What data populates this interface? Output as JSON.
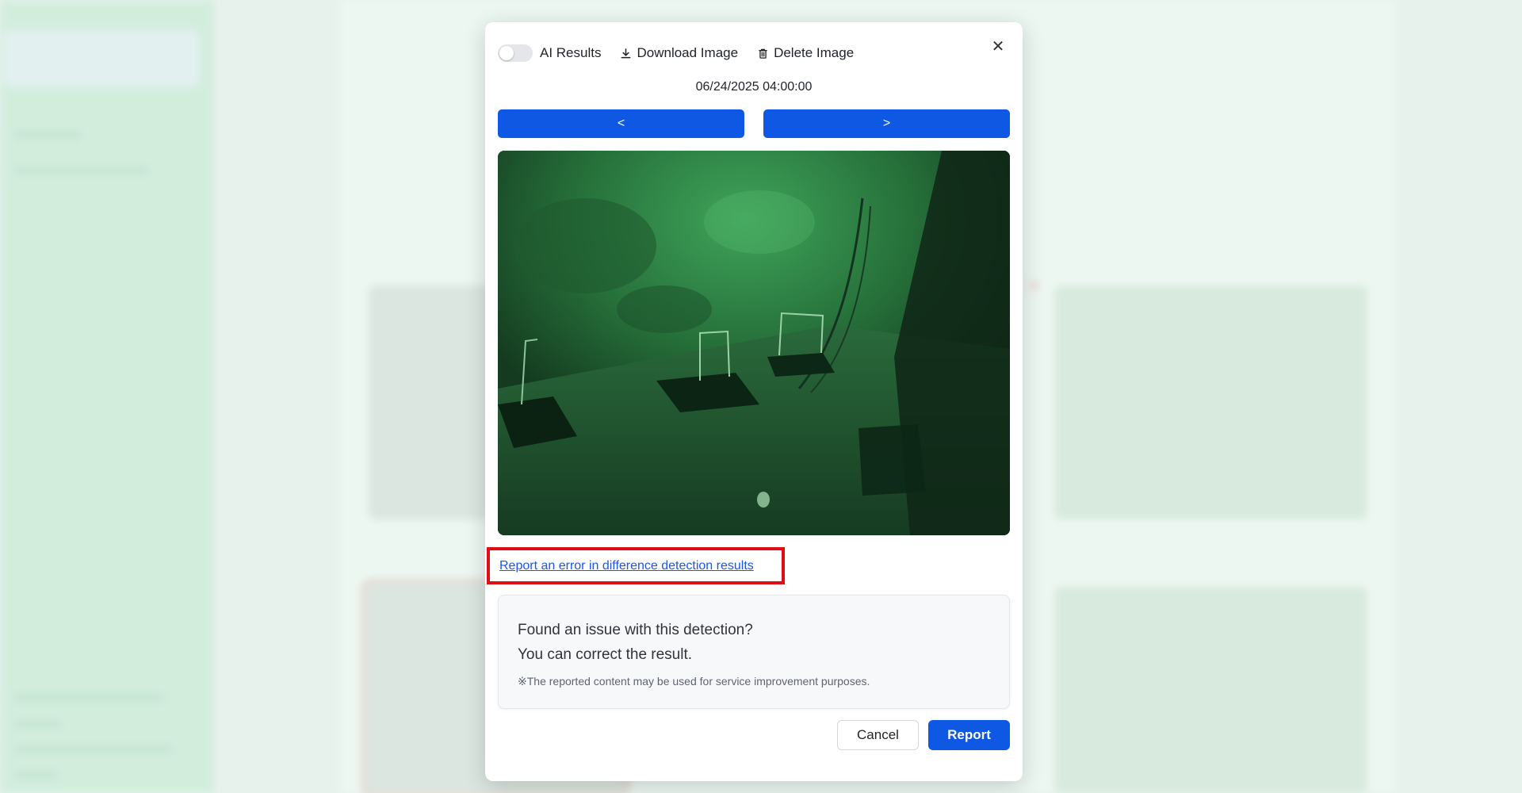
{
  "toolbar": {
    "ai_results_label": "AI Results",
    "download_label": "Download Image",
    "delete_label": "Delete Image"
  },
  "viewer": {
    "timestamp": "06/24/2025 04:00:00",
    "prev_label": "<",
    "next_label": ">"
  },
  "report": {
    "link_text": "Report an error in difference detection results",
    "info_line1": "Found an issue with this detection?",
    "info_line2": "You can correct the result.",
    "note": "※The reported content may be used for service improvement purposes."
  },
  "actions": {
    "cancel_label": "Cancel",
    "report_label": "Report"
  },
  "colors": {
    "primary": "#0e58e3",
    "highlight_border": "#e00d17",
    "link": "#1c56e6"
  }
}
